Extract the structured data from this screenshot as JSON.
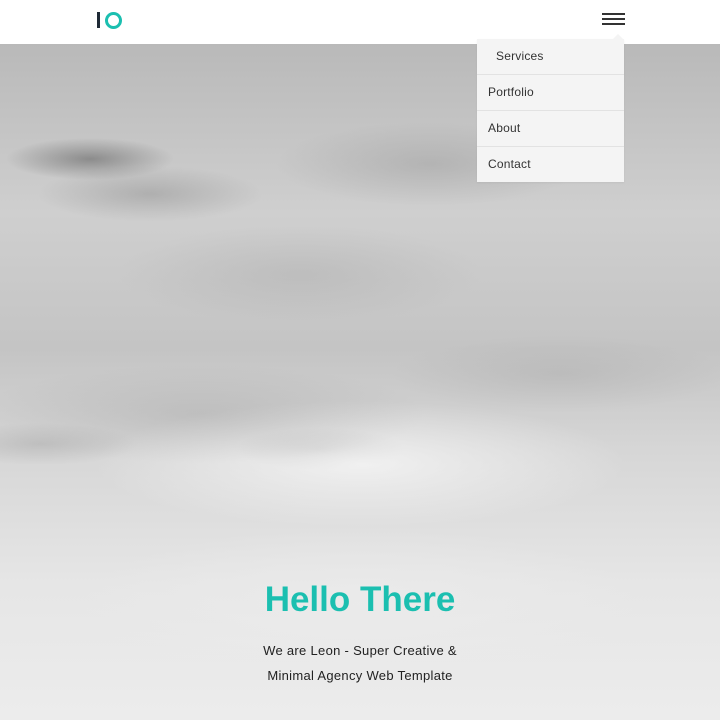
{
  "brand": {
    "accent_color": "#1bbfb0",
    "logo_icon": "io-logo-icon"
  },
  "header": {
    "menu_icon": "hamburger-menu-icon"
  },
  "menu": {
    "items": [
      {
        "label": "Services",
        "active": true
      },
      {
        "label": "Portfolio"
      },
      {
        "label": "About"
      },
      {
        "label": "Contact"
      }
    ]
  },
  "hero": {
    "title": "Hello There",
    "subtitle_line1": "We are Leon - Super Creative &",
    "subtitle_line2": "Minimal Agency Web Template"
  }
}
